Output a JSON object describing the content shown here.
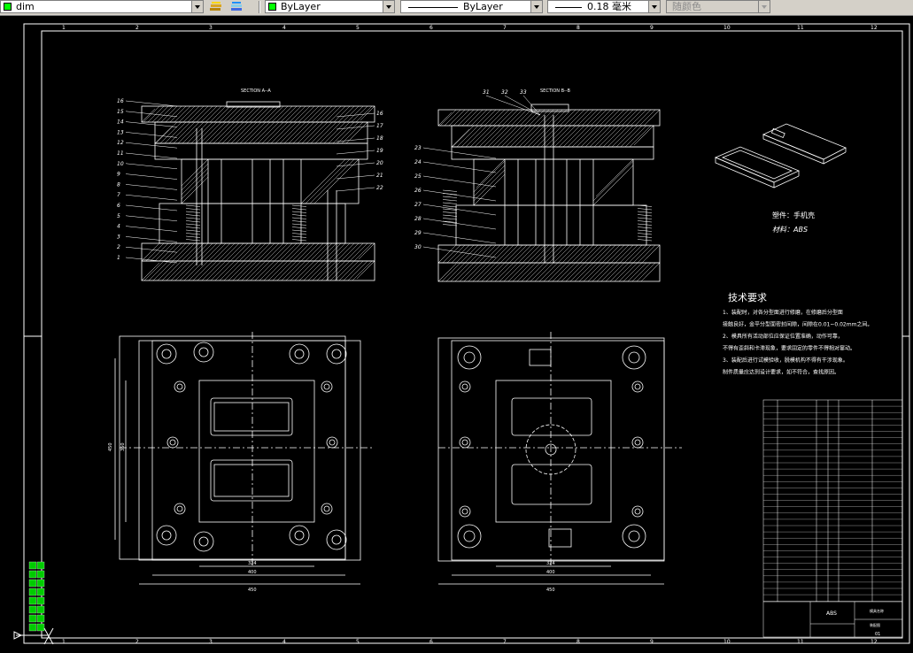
{
  "toolbar": {
    "dimstyle": {
      "value": "dim",
      "color": "#00ff00"
    },
    "layer": {
      "value": "ByLayer",
      "color": "#00ff00"
    },
    "linetype": {
      "value": "ByLayer"
    },
    "lineweight": {
      "value": "0.18 毫米"
    },
    "plotstyle": {
      "value": "随颜色"
    }
  },
  "drawing": {
    "col_numbers": [
      "1",
      "2",
      "3",
      "4",
      "5",
      "6",
      "7",
      "8",
      "9",
      "10",
      "11",
      "12"
    ],
    "section_aa": "SECTION A--A",
    "section_bb": "SECTION B--B",
    "left_callouts": [
      "16",
      "15",
      "14",
      "13",
      "12",
      "11",
      "10",
      "9",
      "8",
      "7",
      "6",
      "5",
      "4",
      "3",
      "2",
      "1"
    ],
    "right_callouts_a": [
      "16",
      "17",
      "18",
      "19",
      "20",
      "21",
      "22"
    ],
    "left_callouts_b": [
      "23",
      "24",
      "25",
      "26",
      "27",
      "28",
      "29",
      "30"
    ],
    "top_callouts_b": [
      "31",
      "32",
      "33"
    ],
    "part_name": "塑件：手机壳",
    "material": "材料：ABS",
    "tech_title": "技术要求",
    "tech_lines": [
      "1、装配时，对各分型面进行修磨，在修磨后分型面",
      "接触良好，金平分型面密封间隙，间隙在0.01~0.02mm之间。",
      "2、模具所有活动部位应保证位置准确，动作可靠，",
      "不得有歪斜和卡滞现象，要求固定的零件不得相对窜动。",
      "3、装配后进行试模验收，脱模机构不得有干涉现象。",
      "制件质量应达到设计要求，如不符合，查找原因。"
    ],
    "dim_bottom_left": [
      "324",
      "400",
      "450"
    ],
    "dim_bottom_right": [
      "324",
      "400",
      "450"
    ],
    "dim_side": [
      "450",
      "350"
    ],
    "title_block": {
      "material": "ABS",
      "code": "模具名称",
      "unit": "装配图",
      "sheet": "01"
    }
  }
}
